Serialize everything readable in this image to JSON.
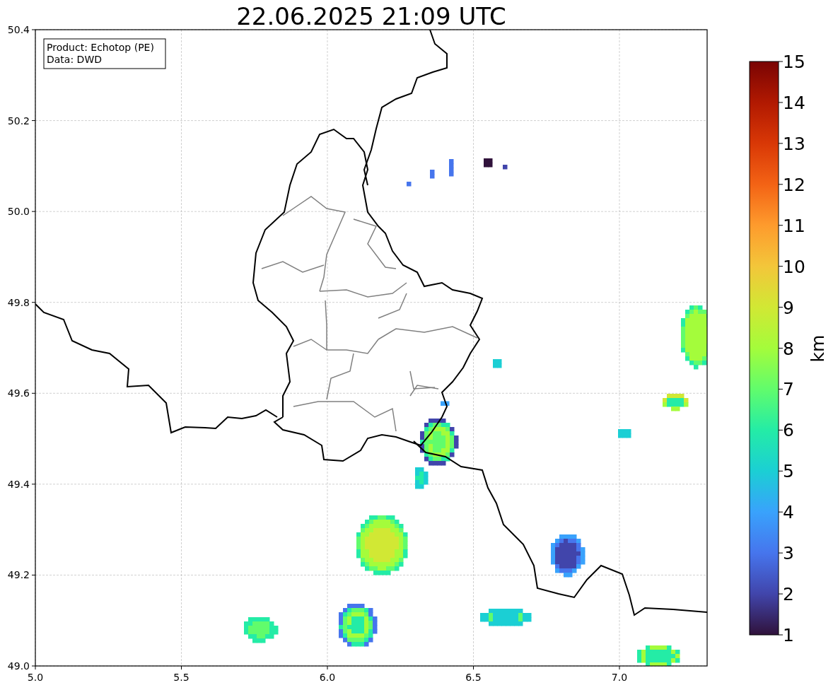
{
  "title": "22.06.2025 21:09 UTC",
  "info_box": [
    "Product: Echotop (PE)",
    "Data: DWD"
  ],
  "x_ticks": [
    "5.0",
    "5.5",
    "6.0",
    "6.5",
    "7.0"
  ],
  "y_ticks": [
    "50.4",
    "50.2",
    "50.0",
    "49.8",
    "49.6",
    "49.4",
    "49.2",
    "49.0"
  ],
  "colorbar": {
    "label": "km",
    "ticks": [
      "15",
      "14",
      "13",
      "12",
      "11",
      "10",
      "9",
      "8",
      "7",
      "6",
      "5",
      "4",
      "3",
      "2",
      "1"
    ]
  }
}
